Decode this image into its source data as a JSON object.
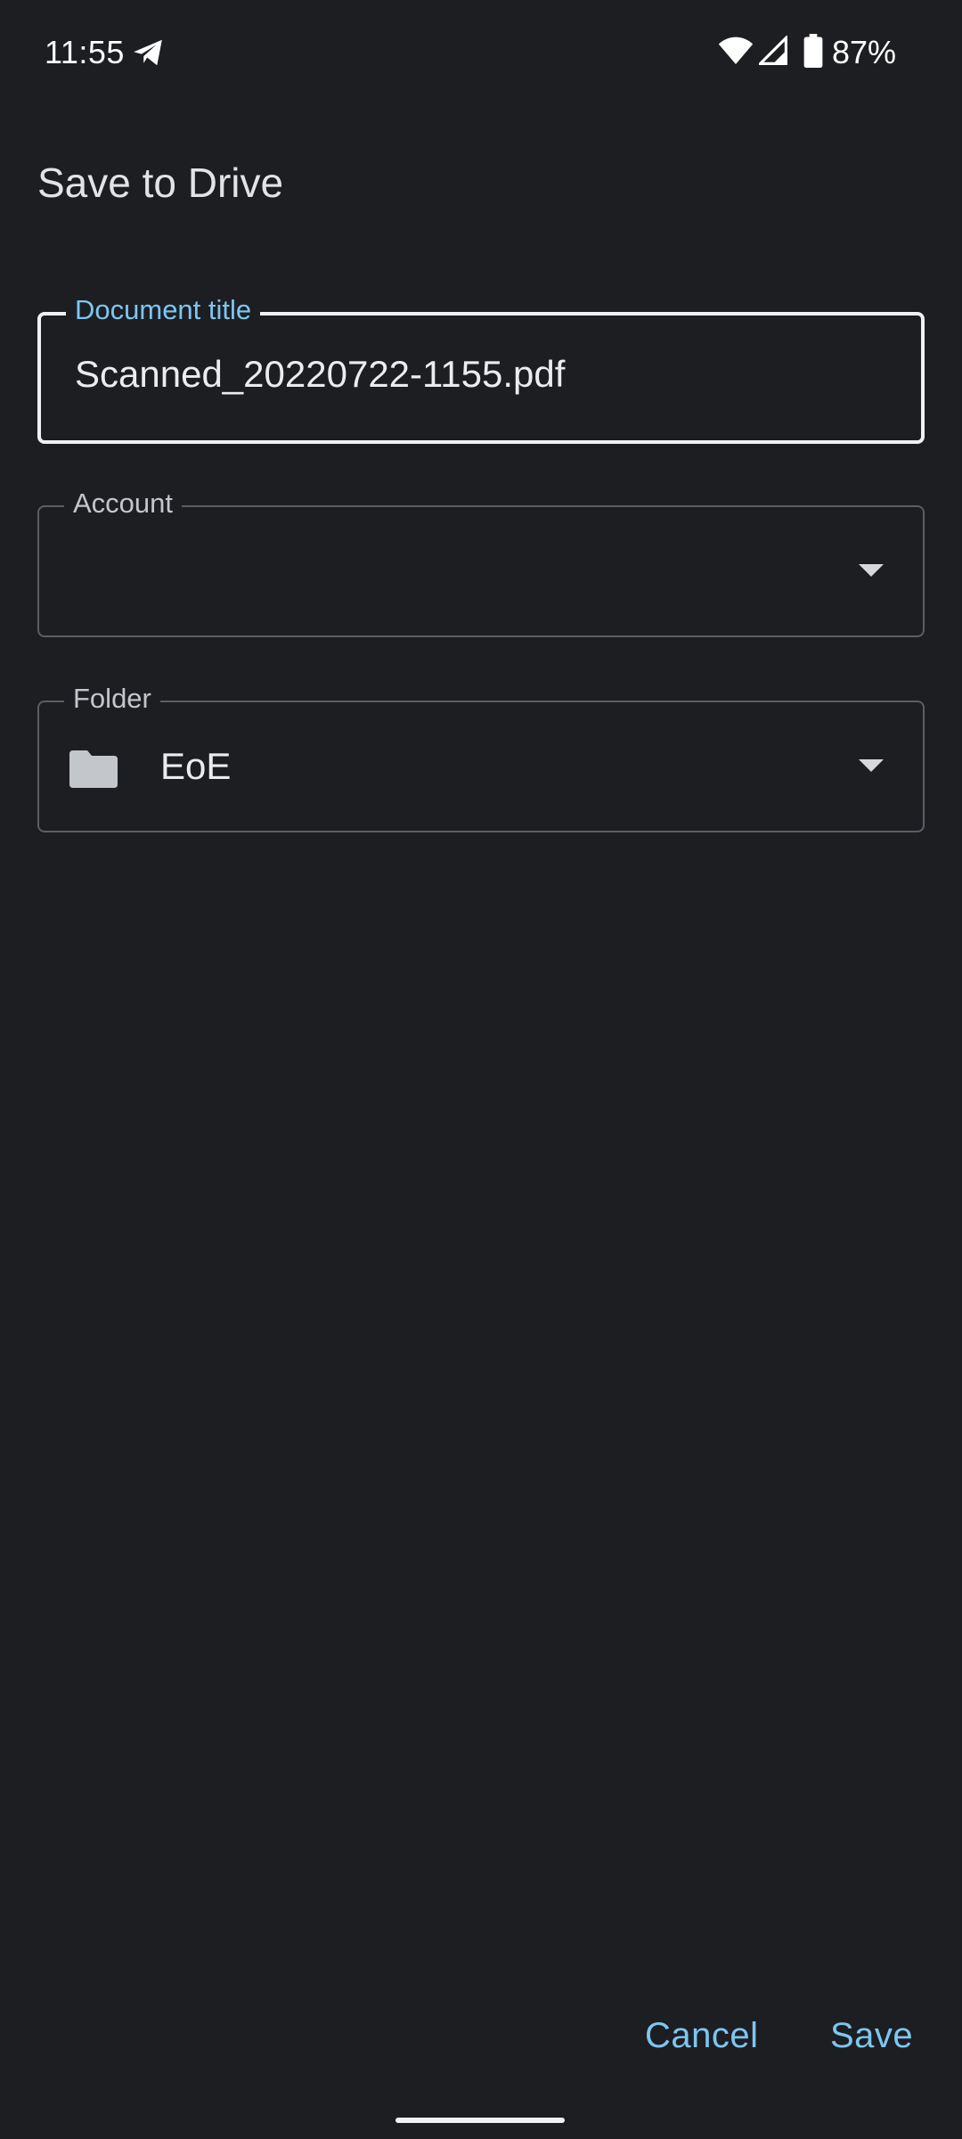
{
  "status_bar": {
    "time": "11:55",
    "battery": "87%",
    "icons": [
      "telegram-icon",
      "wifi-icon",
      "signal-icon",
      "battery-icon"
    ]
  },
  "dialog": {
    "title": "Save to Drive",
    "document_title": {
      "label": "Document title",
      "value": "Scanned_20220722-1155.pdf"
    },
    "account": {
      "label": "Account",
      "value": ""
    },
    "folder": {
      "label": "Folder",
      "value": "EoE",
      "icon": "folder-icon"
    },
    "actions": {
      "cancel": "Cancel",
      "save": "Save"
    }
  },
  "colors": {
    "background": "#1d1e22",
    "accent": "#7cc6f2",
    "text": "#e3e3e6",
    "outline": "#5c5e63",
    "focused_outline": "#f1f1f3"
  }
}
